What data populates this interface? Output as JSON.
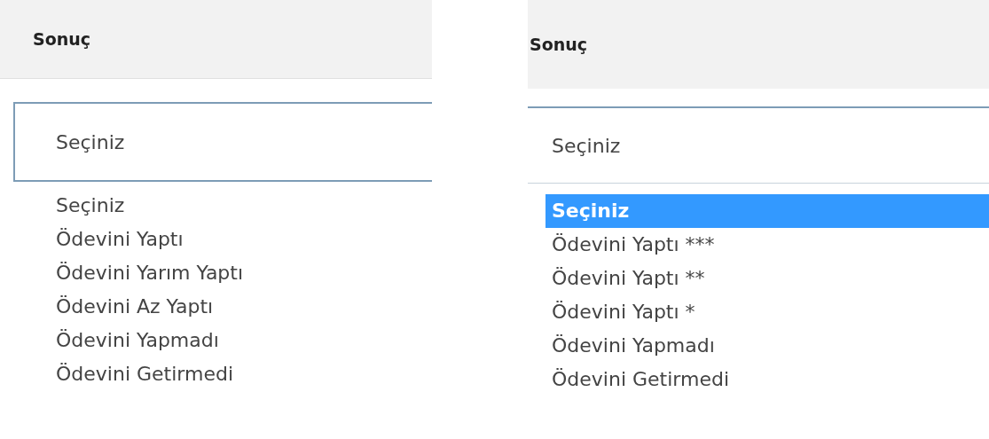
{
  "panels": [
    {
      "header": "Sonuç",
      "select": {
        "value": "Seçiniz",
        "bordered": true
      },
      "options": [
        {
          "label": "Seçiniz",
          "selected": false
        },
        {
          "label": "Ödevini Yaptı",
          "selected": false
        },
        {
          "label": "Ödevini Yarım Yaptı",
          "selected": false
        },
        {
          "label": "Ödevini Az Yaptı",
          "selected": false
        },
        {
          "label": "Ödevini Yapmadı",
          "selected": false
        },
        {
          "label": "Ödevini Getirmedi",
          "selected": false
        }
      ]
    },
    {
      "header": "Sonuç",
      "select": {
        "value": "Seçiniz",
        "bordered": false
      },
      "options": [
        {
          "label": "Seçiniz",
          "selected": true
        },
        {
          "label": "Ödevini Yaptı ***",
          "selected": false
        },
        {
          "label": "Ödevini Yaptı **",
          "selected": false
        },
        {
          "label": "Ödevini Yaptı *",
          "selected": false
        },
        {
          "label": "Ödevini Yapmadı",
          "selected": false
        },
        {
          "label": "Ödevini Getirmedi",
          "selected": false
        }
      ]
    }
  ]
}
